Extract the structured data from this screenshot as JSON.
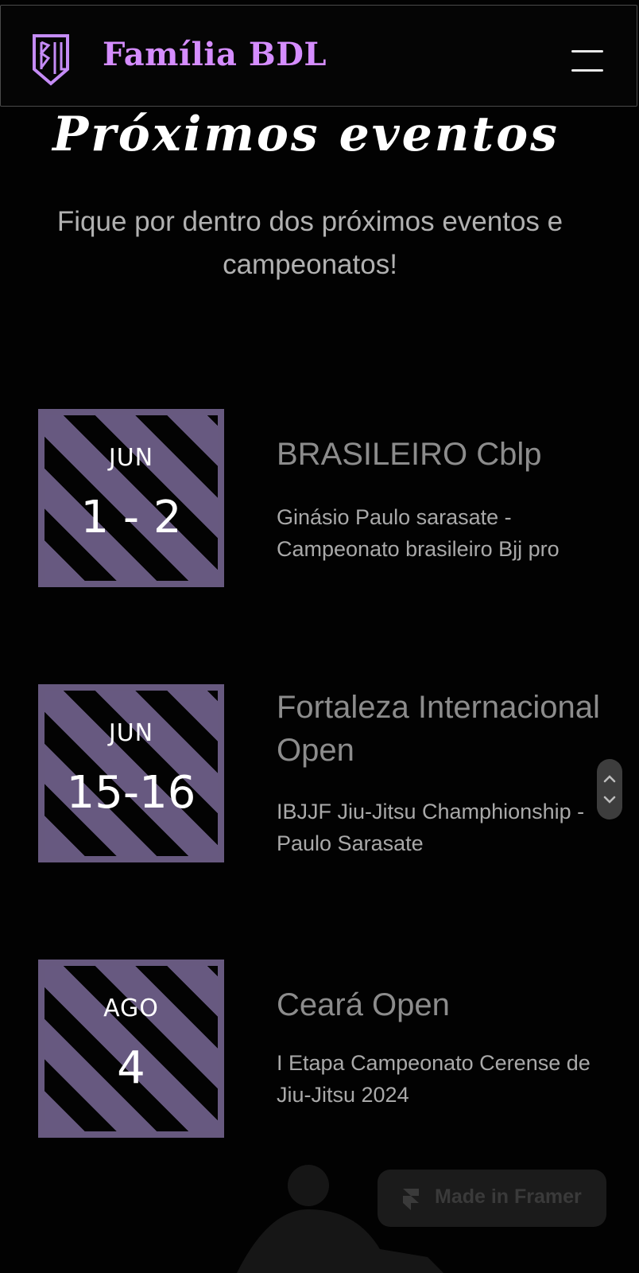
{
  "header": {
    "logo_text": "BDL",
    "brand": "Família BDL",
    "menu_icon": "hamburger-menu-icon"
  },
  "hero": {
    "title": "Próximos eventos",
    "subtitle": "Fique por dentro dos próximos eventos e campeonatos!"
  },
  "events": [
    {
      "month": "JUN",
      "days": "1 - 2",
      "name": "BRASILEIRO Cblp",
      "description": "Ginásio Paulo sarasate - Campeonato brasileiro Bjj pro"
    },
    {
      "month": "JUN",
      "days": "15-16",
      "name": "Fortaleza Internacional Open",
      "description": "IBJJF Jiu-Jitsu Champhionship - Paulo Sarasate"
    },
    {
      "month": "AGO",
      "days": "4",
      "name": "Ceará Open",
      "description": "I Etapa Campeonato Cerense de Jiu-Jitsu 2024"
    }
  ],
  "badge": {
    "label": "Made in Framer",
    "icon": "framer-icon"
  },
  "colors": {
    "background": "#020202",
    "accent": "#d58dff",
    "badge_purple": "#67597f",
    "muted_text": "#8c8c8c"
  }
}
